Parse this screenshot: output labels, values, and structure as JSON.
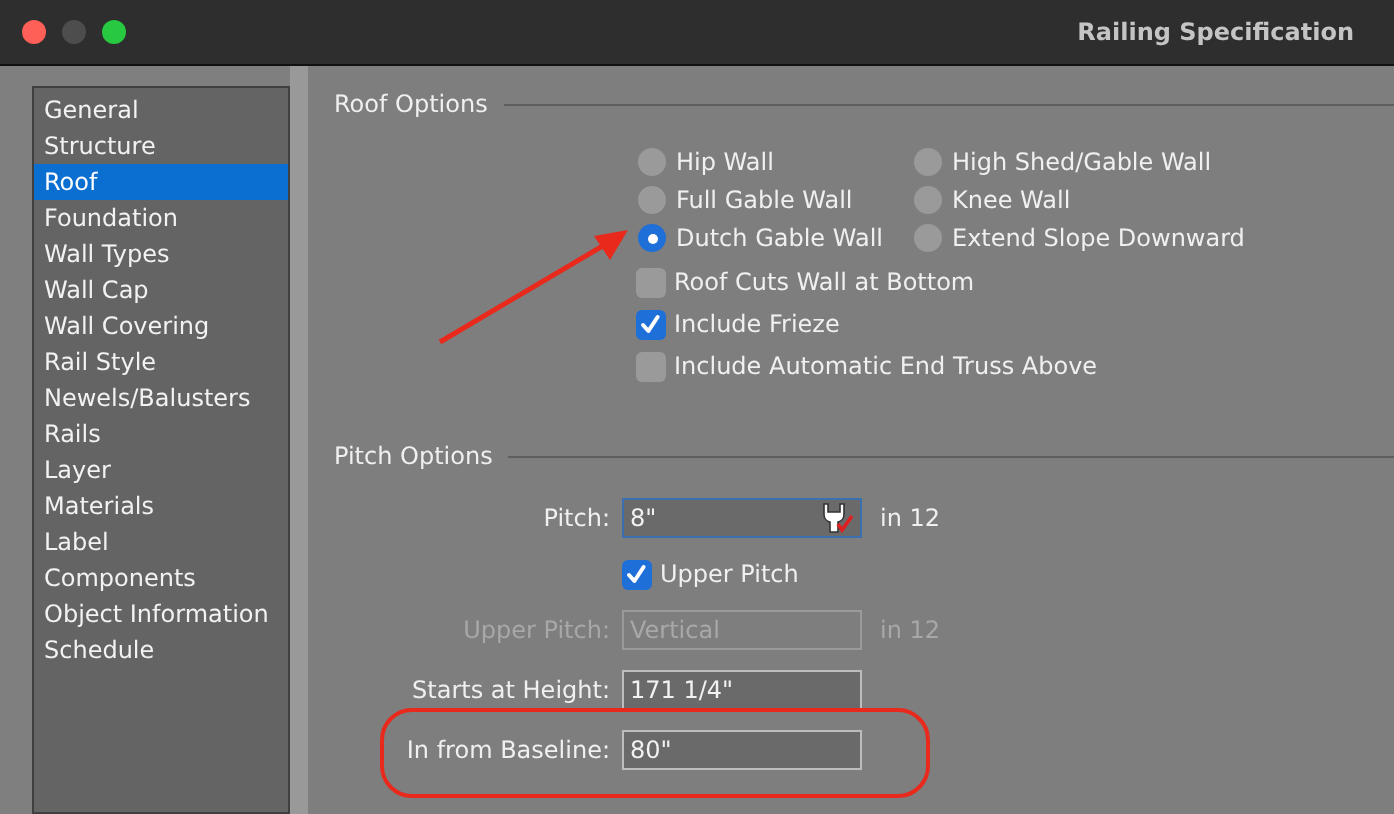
{
  "window": {
    "title": "Railing Specification"
  },
  "sidebar": {
    "items": [
      {
        "label": "General",
        "selected": false
      },
      {
        "label": "Structure",
        "selected": false
      },
      {
        "label": "Roof",
        "selected": true
      },
      {
        "label": "Foundation",
        "selected": false
      },
      {
        "label": "Wall Types",
        "selected": false
      },
      {
        "label": "Wall Cap",
        "selected": false
      },
      {
        "label": "Wall Covering",
        "selected": false
      },
      {
        "label": "Rail Style",
        "selected": false
      },
      {
        "label": "Newels/Balusters",
        "selected": false
      },
      {
        "label": "Rails",
        "selected": false
      },
      {
        "label": "Layer",
        "selected": false
      },
      {
        "label": "Materials",
        "selected": false
      },
      {
        "label": "Label",
        "selected": false
      },
      {
        "label": "Components",
        "selected": false
      },
      {
        "label": "Object Information",
        "selected": false
      },
      {
        "label": "Schedule",
        "selected": false
      }
    ]
  },
  "roof_options": {
    "title": "Roof Options",
    "wall_types": [
      {
        "label": "Hip Wall",
        "selected": false
      },
      {
        "label": "High Shed/Gable Wall",
        "selected": false
      },
      {
        "label": "Full Gable Wall",
        "selected": false
      },
      {
        "label": "Knee Wall",
        "selected": false
      },
      {
        "label": "Dutch Gable Wall",
        "selected": true
      },
      {
        "label": "Extend Slope Downward",
        "selected": false
      }
    ],
    "checkboxes": [
      {
        "label": "Roof Cuts Wall at Bottom",
        "checked": false
      },
      {
        "label": "Include Frieze",
        "checked": true
      },
      {
        "label": "Include Automatic End Truss Above",
        "checked": false
      }
    ]
  },
  "pitch_options": {
    "title": "Pitch Options",
    "rows": [
      {
        "kind": "field",
        "label": "Pitch:",
        "value": "8\"",
        "suffix": "in 12",
        "disabled": false,
        "focused": true
      },
      {
        "kind": "checkbox",
        "label": "Upper Pitch",
        "checked": true
      },
      {
        "kind": "field",
        "label": "Upper Pitch:",
        "value": "Vertical",
        "suffix": "in 12",
        "disabled": true,
        "focused": false
      },
      {
        "kind": "field",
        "label": "Starts at Height:",
        "value": "171 1/4\"",
        "disabled": false,
        "focused": false
      },
      {
        "kind": "field",
        "label": "In from Baseline:",
        "value": "80\"",
        "disabled": false,
        "focused": false
      }
    ]
  }
}
